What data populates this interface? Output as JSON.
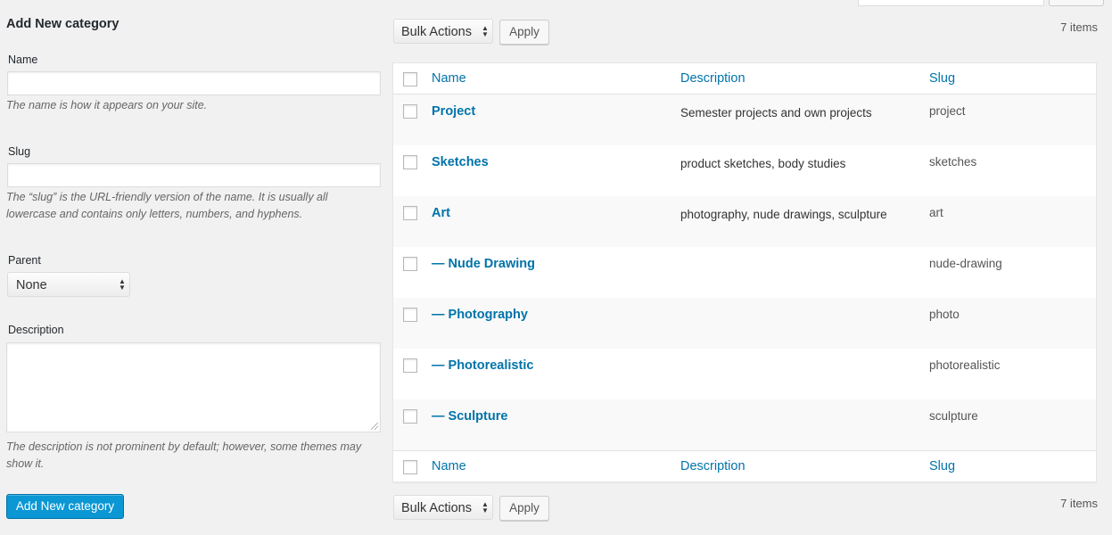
{
  "form": {
    "title": "Add New category",
    "name_label": "Name",
    "name_value": "",
    "name_hint": "The name is how it appears on your site.",
    "slug_label": "Slug",
    "slug_value": "",
    "slug_hint": "The “slug” is the URL-friendly version of the name. It is usually all lowercase and contains only letters, numbers, and hyphens.",
    "parent_label": "Parent",
    "parent_value": "None",
    "description_label": "Description",
    "description_value": "",
    "description_hint": "The description is not prominent by default; however, some themes may show it.",
    "submit_label": "Add New category"
  },
  "list": {
    "bulk_actions_label": "Bulk Actions",
    "apply_label": "Apply",
    "items_count": "7 items",
    "columns": {
      "name": "Name",
      "description": "Description",
      "slug": "Slug"
    },
    "rows": [
      {
        "name": "Project",
        "description": "Semester projects and own projects",
        "slug": "project"
      },
      {
        "name": "Sketches",
        "description": "product sketches, body studies",
        "slug": "sketches"
      },
      {
        "name": "Art",
        "description": "photography, nude drawings, sculpture",
        "slug": "art"
      },
      {
        "name": "— Nude Drawing",
        "description": "",
        "slug": "nude-drawing"
      },
      {
        "name": "— Photography",
        "description": "",
        "slug": "photo"
      },
      {
        "name": "— Photorealistic",
        "description": "",
        "slug": "photorealistic"
      },
      {
        "name": "— Sculpture",
        "description": "",
        "slug": "sculpture"
      }
    ]
  },
  "colors": {
    "link": "#0073aa",
    "primary_button": "#0a97d4",
    "background": "#f1f1f1"
  }
}
